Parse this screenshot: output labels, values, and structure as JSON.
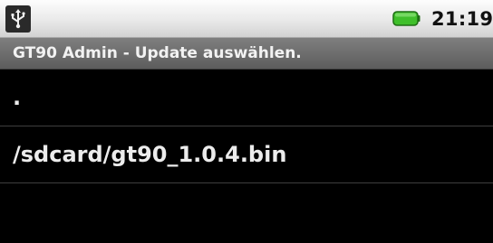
{
  "status_bar": {
    "icons": [
      "usb-icon",
      "battery-icon"
    ],
    "battery_color": "#3fbf2a",
    "time": "21:19"
  },
  "title_bar": {
    "title": "GT90 Admin - Update auswählen."
  },
  "file_list": {
    "items": [
      {
        "label": "."
      },
      {
        "label": "/sdcard/gt90_1.0.4.bin"
      }
    ]
  },
  "colors": {
    "background": "#000000",
    "title_bar": "#6e6e6e",
    "status_bar": "#e6e6e6",
    "divider": "#3e3e3e"
  }
}
